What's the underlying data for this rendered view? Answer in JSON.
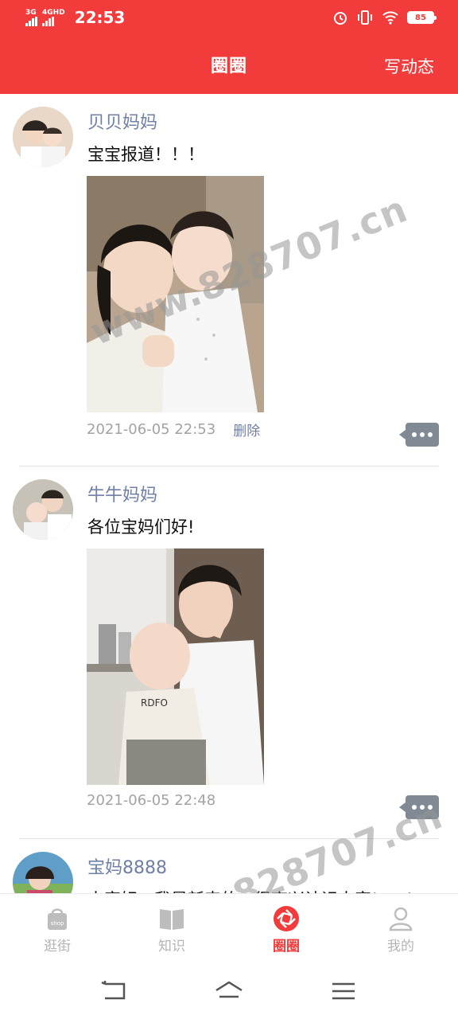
{
  "status_bar": {
    "signal1_label": "3G",
    "signal2_label": "4GHD",
    "time": "22:53",
    "battery": "85"
  },
  "header": {
    "title": "圈圈",
    "write_post": "写动态"
  },
  "posts": [
    {
      "username": "贝贝妈妈",
      "text": "宝宝报道！！！",
      "timestamp": "2021-06-05 22:53",
      "delete_label": "删除"
    },
    {
      "username": "牛牛妈妈",
      "text": "各位宝妈们好!",
      "timestamp": "2021-06-05 22:48",
      "delete_label": ""
    },
    {
      "username": "宝妈8888",
      "text": "大家好，我是新来的，很高兴认识大家!~~!",
      "timestamp": "",
      "delete_label": ""
    }
  ],
  "watermark": "www.828707.cn",
  "tabbar": {
    "tabs": [
      {
        "label": "逛街",
        "icon": "shop-bag-icon",
        "active": false
      },
      {
        "label": "知识",
        "icon": "book-icon",
        "active": false
      },
      {
        "label": "圈圈",
        "icon": "camera-aperture-icon",
        "active": true
      },
      {
        "label": "我的",
        "icon": "person-icon",
        "active": false
      }
    ]
  },
  "colors": {
    "brand_red": "#f23c3c",
    "username_blue": "#6f80a6",
    "inactive_gray": "#b5b5b5"
  }
}
